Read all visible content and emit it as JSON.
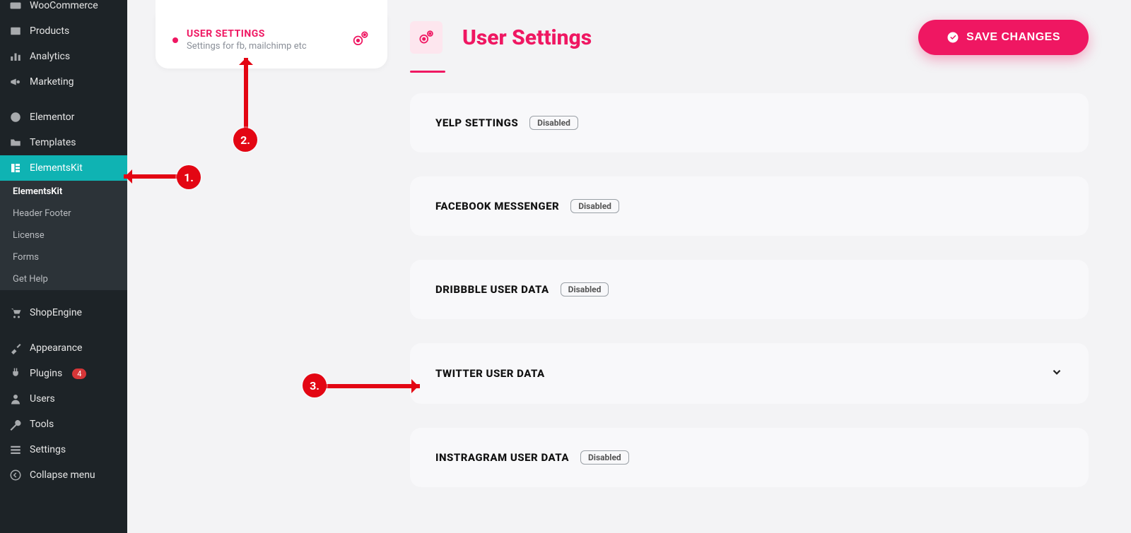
{
  "sidebar": {
    "items": [
      {
        "label": "WooCommerce",
        "icon": "woo"
      },
      {
        "label": "Products",
        "icon": "tag"
      },
      {
        "label": "Analytics",
        "icon": "bars"
      },
      {
        "label": "Marketing",
        "icon": "megaphone"
      },
      {
        "label": "Elementor",
        "icon": "e-circle"
      },
      {
        "label": "Templates",
        "icon": "folder"
      },
      {
        "label": "ElementsKit",
        "icon": "ekit",
        "active": true
      },
      {
        "label": "ShopEngine",
        "icon": "cart"
      },
      {
        "label": "Appearance",
        "icon": "brush"
      },
      {
        "label": "Plugins",
        "icon": "plug",
        "badge": "4"
      },
      {
        "label": "Users",
        "icon": "user"
      },
      {
        "label": "Tools",
        "icon": "wrench"
      },
      {
        "label": "Settings",
        "icon": "sliders"
      },
      {
        "label": "Collapse menu",
        "icon": "collapse"
      }
    ],
    "subitems": [
      {
        "label": "ElementsKit",
        "current": true
      },
      {
        "label": "Header Footer"
      },
      {
        "label": "License"
      },
      {
        "label": "Forms"
      },
      {
        "label": "Get Help"
      }
    ]
  },
  "tab": {
    "title": "USER SETTINGS",
    "subtitle": "Settings for fb, mailchimp etc"
  },
  "header": {
    "title": "User Settings",
    "save": "SAVE CHANGES"
  },
  "panels": [
    {
      "title": "YELP SETTINGS",
      "status": "Disabled"
    },
    {
      "title": "FACEBOOK MESSENGER",
      "status": "Disabled"
    },
    {
      "title": "DRIBBBLE USER DATA",
      "status": "Disabled"
    },
    {
      "title": "TWITTER USER DATA",
      "status": null,
      "chevron": true
    },
    {
      "title": "INSTRAGRAM USER DATA",
      "status": "Disabled"
    }
  ],
  "annotations": {
    "a1": "1.",
    "a2": "2.",
    "a3": "3."
  }
}
